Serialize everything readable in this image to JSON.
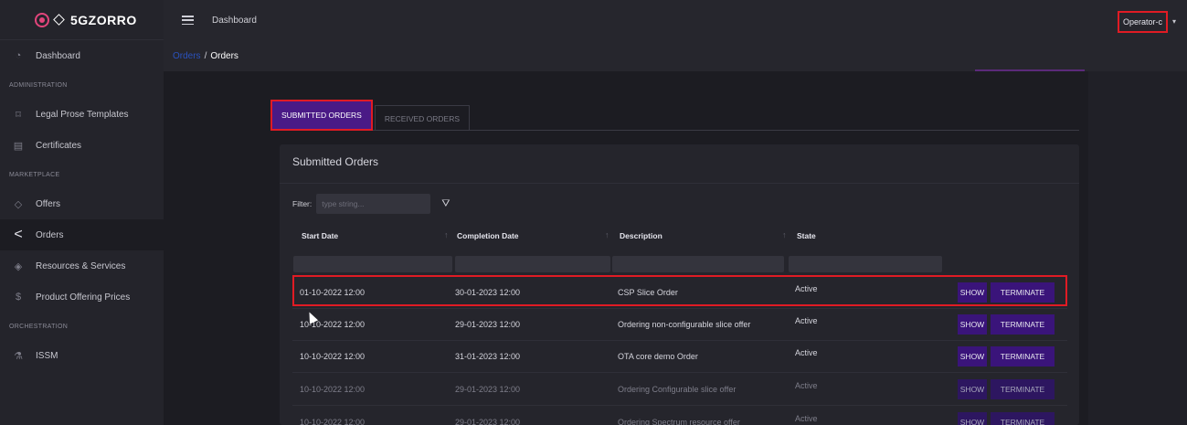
{
  "brand": {
    "name": "5GZORRO"
  },
  "topbar": {
    "title": "Dashboard",
    "user": "Operator-c"
  },
  "breadcrumb": {
    "parent": "Orders",
    "current": "Orders"
  },
  "sidebar": {
    "dashboard": "Dashboard",
    "sections": [
      {
        "title": "ADMINISTRATION",
        "items": [
          "Legal Prose Templates",
          "Certificates"
        ]
      },
      {
        "title": "MARKETPLACE",
        "items": [
          "Offers",
          "Orders",
          "Resources & Services",
          "Product Offering Prices"
        ]
      },
      {
        "title": "ORCHESTRATION",
        "items": [
          "ISSM"
        ]
      }
    ]
  },
  "tabs": {
    "submitted": "SUBMITTED ORDERS",
    "received": "RECEIVED ORDERS"
  },
  "card": {
    "title": "Submitted Orders"
  },
  "filter": {
    "label": "Filter:",
    "placeholder": "type string..."
  },
  "table": {
    "columns": [
      "Start Date",
      "Completion Date",
      "Description",
      "State"
    ],
    "rows": [
      {
        "start": "01-10-2022 12:00",
        "end": "30-01-2023 12:00",
        "desc": "CSP Slice Order",
        "state": "Active"
      },
      {
        "start": "10-10-2022 12:00",
        "end": "29-01-2023 12:00",
        "desc": "Ordering non-configurable slice offer",
        "state": "Active"
      },
      {
        "start": "10-10-2022 12:00",
        "end": "31-01-2023 12:00",
        "desc": "OTA core demo Order",
        "state": "Active"
      },
      {
        "start": "10-10-2022 12:00",
        "end": "29-01-2023 12:00",
        "desc": "Ordering Configurable slice offer",
        "state": "Active"
      },
      {
        "start": "10-10-2022 12:00",
        "end": "29-01-2023 12:00",
        "desc": "Ordering Spectrum resource offer",
        "state": "Active"
      }
    ],
    "show_label": "SHOW",
    "terminate_label": "TERMINATE"
  }
}
